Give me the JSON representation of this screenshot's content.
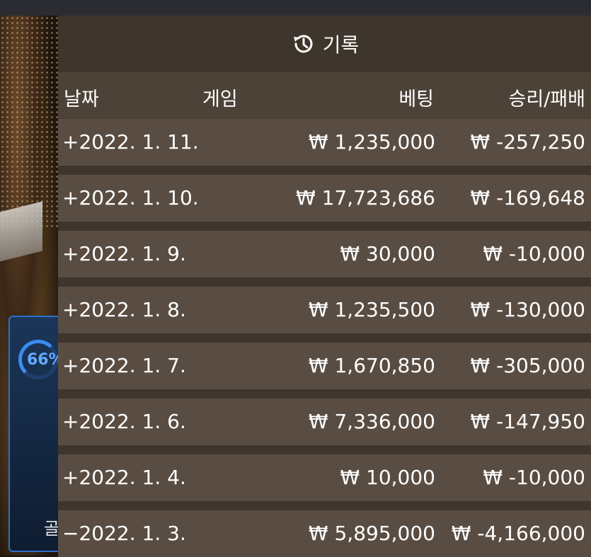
{
  "title": "기록",
  "icon": "history-icon",
  "columns": {
    "date": "날짜",
    "game": "게임",
    "bet": "베팅",
    "result": "승리/패배"
  },
  "rows": [
    {
      "date": "+2022. 1. 11.",
      "bet": "₩ 1,235,000",
      "result": "₩ -257,250"
    },
    {
      "date": "+2022. 1. 10.",
      "bet": "₩ 17,723,686",
      "result": "₩ -169,648"
    },
    {
      "date": "+2022. 1. 9.",
      "bet": "₩ 30,000",
      "result": "₩ -10,000"
    },
    {
      "date": "+2022. 1. 8.",
      "bet": "₩ 1,235,500",
      "result": "₩ -130,000"
    },
    {
      "date": "+2022. 1. 7.",
      "bet": "₩ 1,670,850",
      "result": "₩ -305,000"
    },
    {
      "date": "+2022. 1. 6.",
      "bet": "₩ 7,336,000",
      "result": "₩ -147,950"
    },
    {
      "date": "+2022. 1. 4.",
      "bet": "₩ 10,000",
      "result": "₩ -10,000"
    },
    {
      "date": "−2022. 1. 3.",
      "bet": "₩ 5,895,000",
      "result": "₩ -4,166,000"
    }
  ],
  "background": {
    "progress_text": "66%",
    "promo_text": "골"
  }
}
